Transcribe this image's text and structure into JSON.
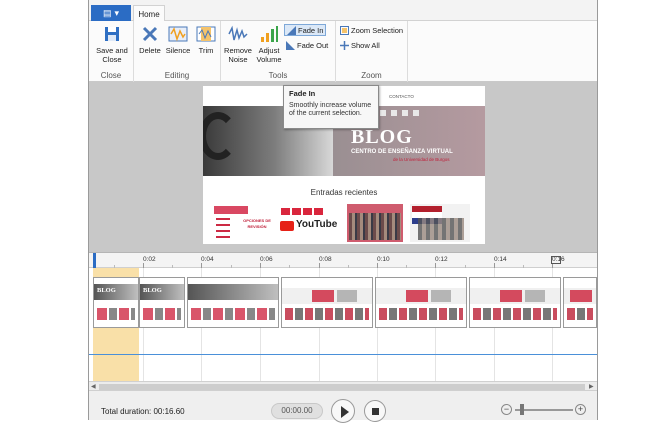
{
  "ribbon": {
    "tab_home": "Home",
    "groups": {
      "close": "Close",
      "editing": "Editing",
      "tools": "Tools",
      "zoom": "Zoom"
    },
    "buttons": {
      "save_and_close": "Save and Close",
      "delete": "Delete",
      "silence": "Silence",
      "trim": "Trim",
      "remove_noise": "Remove Noise",
      "adjust_volume": "Adjust Volume",
      "fade_in": "Fade In",
      "fade_out": "Fade Out",
      "zoom_selection": "Zoom Selection",
      "show_all": "Show All"
    }
  },
  "tooltip": {
    "title": "Fade In",
    "body": "Smoothly increase volume of the current selection."
  },
  "preview": {
    "nav_contact": "CONTACTO",
    "blog_title": "BLOG",
    "blog_subtitle": "CENTRO DE ENSEÑANZA VIRTUAL",
    "blog_subtitle2": "de la Universidad de Burgos",
    "recent_entries": "Entradas recientes",
    "thumb1_text": "OPCIONES DE REVISIÓN",
    "thumb2_text": "YouTube"
  },
  "timeline": {
    "ticks": [
      "0:02",
      "0:04",
      "0:06",
      "0:08",
      "0:10",
      "0:12",
      "0:14",
      "0:16"
    ],
    "clip_label": "BLOG"
  },
  "status": {
    "total_duration": "Total duration: 00:16.60",
    "current_time": "00:00.00"
  },
  "colors": {
    "accent": "#2b6cc4",
    "selection": "#f7d58b",
    "brand_red": "#c0203a"
  }
}
